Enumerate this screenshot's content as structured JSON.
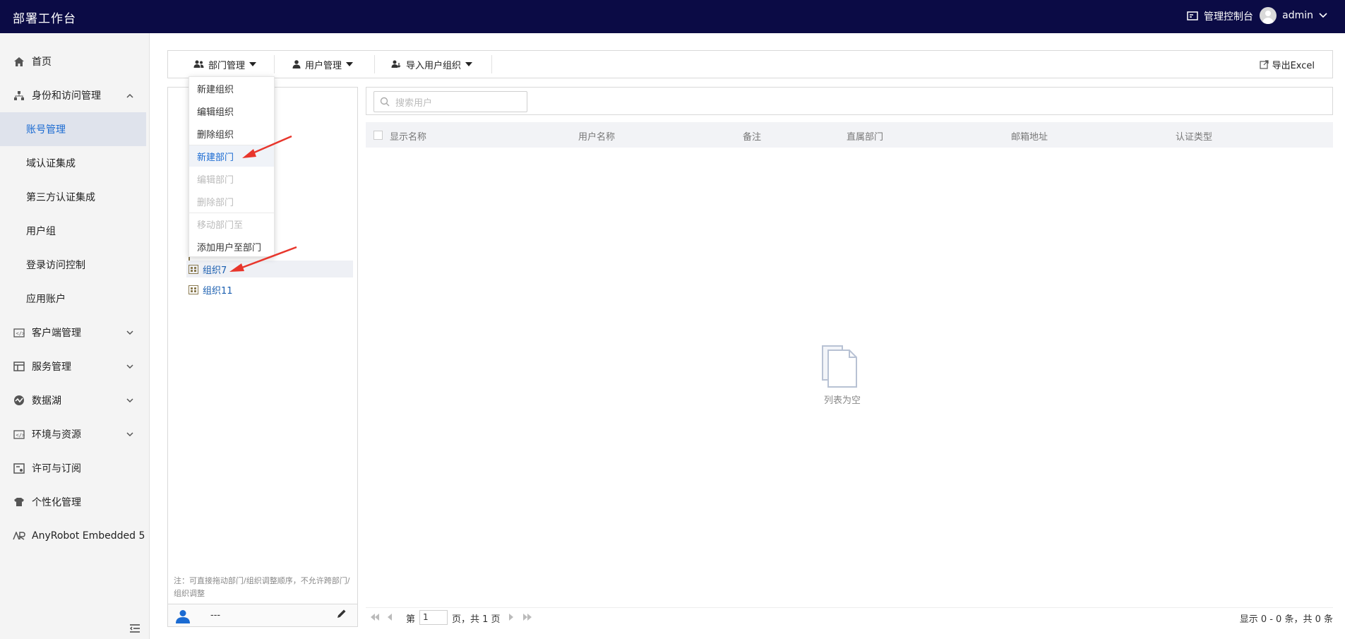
{
  "topbar": {
    "title": "部署工作台",
    "console_label": "管理控制台",
    "username": "admin"
  },
  "sidebar": {
    "items": [
      {
        "label": "首页",
        "icon": "home-icon"
      },
      {
        "label": "身份和访问管理",
        "icon": "org-tree-icon",
        "expanded": true
      },
      {
        "label": "客户端管理",
        "icon": "code-icon"
      },
      {
        "label": "服务管理",
        "icon": "table-icon"
      },
      {
        "label": "数据湖",
        "icon": "datalake-icon"
      },
      {
        "label": "环境与资源",
        "icon": "code-icon"
      },
      {
        "label": "许可与订阅",
        "icon": "license-icon"
      },
      {
        "label": "个性化管理",
        "icon": "shirt-icon"
      },
      {
        "label": "AnyRobot Embedded 5",
        "icon": "anyrobot-icon"
      }
    ],
    "sub_items": [
      "账号管理",
      "域认证集成",
      "第三方认证集成",
      "用户组",
      "登录访问控制",
      "应用账户"
    ],
    "active_sub": "账号管理"
  },
  "toolbar": {
    "dept_menu": "部门管理",
    "user_menu": "用户管理",
    "import_menu": "导入用户组织",
    "export_label": "导出Excel"
  },
  "dropdown": {
    "items": [
      {
        "label": "新建组织",
        "disabled": false
      },
      {
        "label": "编辑组织",
        "disabled": false
      },
      {
        "label": "删除组织",
        "disabled": false
      },
      {
        "label": "新建部门",
        "disabled": false,
        "highlighted": true
      },
      {
        "label": "编辑部门",
        "disabled": true
      },
      {
        "label": "删除部门",
        "disabled": true
      },
      {
        "label": "移动部门至",
        "disabled": true
      },
      {
        "label": "添加用户至部门",
        "disabled": false
      }
    ]
  },
  "tree": {
    "items": [
      {
        "label": "组织7",
        "selected": true
      },
      {
        "label": "组织11",
        "selected": false
      }
    ],
    "note": "注：可直接拖动部门/组织调整顺序，不允许跨部门/组织调整",
    "footer_user": "---"
  },
  "users": {
    "search_placeholder": "搜索用户",
    "columns": [
      "显示名称",
      "用户名称",
      "备注",
      "直属部门",
      "邮箱地址",
      "认证类型"
    ],
    "empty_text": "列表为空"
  },
  "pager": {
    "page_prefix": "第",
    "current_page": "1",
    "page_suffix": "页，共 1 页",
    "summary": "显示 0 - 0 条，共 0 条"
  },
  "colors": {
    "topbar": "#0b0b45",
    "accent": "#1b6bd2",
    "arrow": "#e8362c"
  }
}
